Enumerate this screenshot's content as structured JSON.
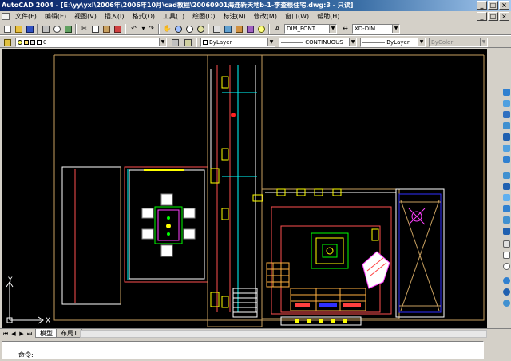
{
  "window": {
    "title": "AutoCAD 2004 - [E:\\yy\\yxl\\2006年\\2006年10月\\cad教程\\20060901海连新天地b-1-李查根住宅.dwg:3 - 只读]",
    "controls": [
      "_",
      "□",
      "×"
    ]
  },
  "menu": {
    "items": [
      "文件(F)",
      "编辑(E)",
      "视图(V)",
      "插入(I)",
      "格式(O)",
      "工具(T)",
      "绘图(D)",
      "标注(N)",
      "修改(M)",
      "窗口(W)",
      "帮助(H)"
    ],
    "doc_controls": [
      "_",
      "□",
      "×"
    ]
  },
  "toolbar": {
    "text_style": "DIM_FONT",
    "dim_style": "XD-DIM",
    "layer": "0",
    "color": "ByLayer",
    "linetype": "CONTINUOUS",
    "lineweight": "ByLayer",
    "plot_style": "ByColor"
  },
  "colors": {
    "canvas": "#000000",
    "wall": "#ff5050",
    "cyan": "#00ffff",
    "yellow": "#ffff00",
    "green": "#00ff00",
    "white": "#ffffff",
    "magenta": "#ff40ff",
    "blue": "#3030ff",
    "orange": "#ffb040",
    "tan": "#c8a060"
  },
  "ucs": {
    "y_label": "Y",
    "x_label": "X"
  },
  "layout_tabs": {
    "items": [
      "模型",
      "布局1"
    ],
    "active": 0
  },
  "command": {
    "prompt": "命令:"
  }
}
